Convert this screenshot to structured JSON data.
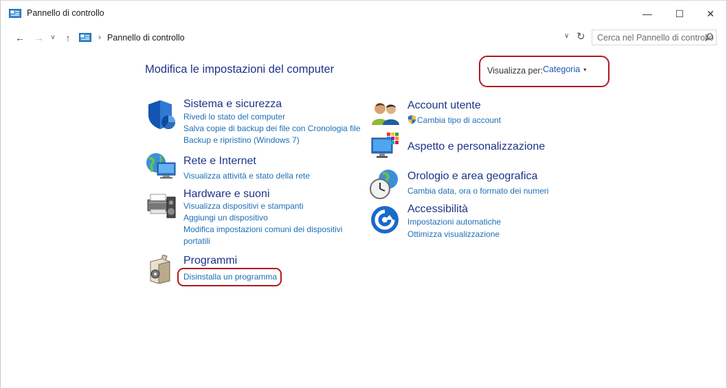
{
  "window": {
    "title": "Pannello di controllo",
    "minimize_glyph": "—",
    "maximize_glyph": "☐",
    "close_glyph": "✕"
  },
  "nav": {
    "back_glyph": "←",
    "forward_glyph": "→",
    "recent_glyph": "∨",
    "up_glyph": "↑",
    "address_separator": "›",
    "address_text": "Pannello di controllo",
    "dropdown_glyph": "∨",
    "refresh_glyph": "↻",
    "search_placeholder": "Cerca nel Pannello di controllo"
  },
  "header": {
    "title": "Modifica le impostazioni del computer",
    "view_by_label": "Visualizza per:",
    "view_by_value": "Categoria",
    "view_by_arrow": "▾"
  },
  "categories": {
    "system": {
      "title": "Sistema e sicurezza",
      "icon": "security-shield-icon",
      "links": [
        "Rivedi lo stato del computer",
        "Salva copie di backup dei file con Cronologia file",
        "Backup e ripristino (Windows 7)"
      ]
    },
    "network": {
      "title": "Rete e Internet",
      "icon": "network-globe-icon",
      "links": [
        "Visualizza attività e stato della rete"
      ]
    },
    "hardware": {
      "title": "Hardware e suoni",
      "icon": "printer-speaker-icon",
      "links": [
        "Visualizza dispositivi e stampanti",
        "Aggiungi un dispositivo",
        "Modifica impostazioni comuni dei dispositivi",
        "portatili"
      ]
    },
    "programs": {
      "title": "Programmi",
      "icon": "programs-box-icon",
      "links": [
        "Disinstalla un programma"
      ]
    },
    "accounts": {
      "title": "Account utente",
      "icon": "users-icon",
      "links": [
        "Cambia tipo di account"
      ]
    },
    "appearance": {
      "title": "Aspetto e personalizzazione",
      "icon": "monitor-palette-icon",
      "links": []
    },
    "clock": {
      "title": "Orologio e area geografica",
      "icon": "clock-globe-icon",
      "links": [
        "Cambia data, ora o formato dei numeri"
      ]
    },
    "ease": {
      "title": "Accessibilità",
      "icon": "accessibility-icon",
      "links": [
        "Impostazioni automatiche",
        "Ottimizza visualizzazione"
      ]
    }
  },
  "colors": {
    "category_title": "#1e3287",
    "link": "#1c6fb5",
    "annotation": "#b0191f"
  }
}
